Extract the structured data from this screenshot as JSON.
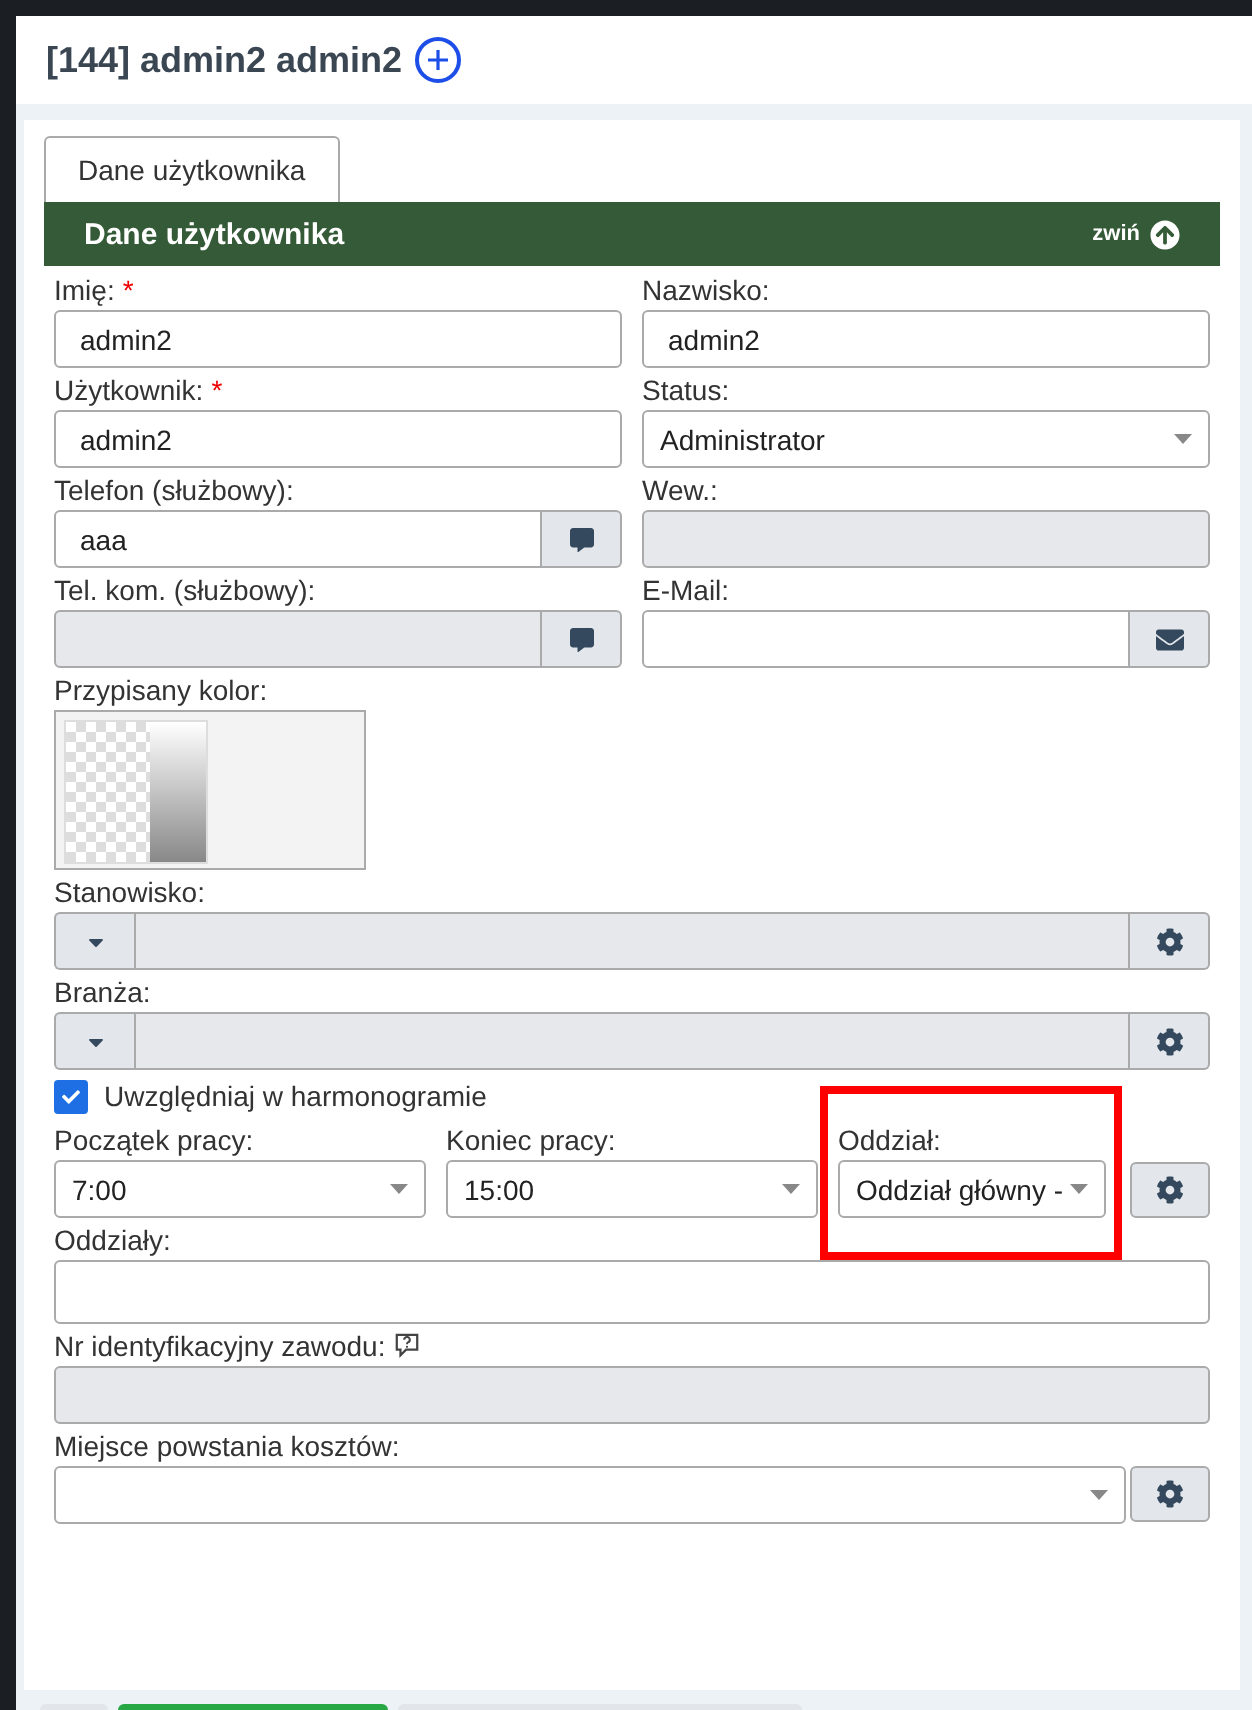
{
  "header": {
    "title": "[144] admin2 admin2"
  },
  "tabs": [
    {
      "label": "Dane użytkownika",
      "selected": true
    }
  ],
  "section": {
    "title": "Dane użytkownika",
    "collapse_label": "zwiń"
  },
  "rows": [
    [
      {
        "kind": "text",
        "label": "Imię:",
        "required_mark": "*",
        "value": "admin2",
        "disabled": false
      },
      {
        "kind": "text",
        "label": "Nazwisko:",
        "value": "admin2",
        "disabled": false
      }
    ],
    [
      {
        "kind": "text",
        "label": "Użytkownik:",
        "required_mark": "*",
        "value": "admin2",
        "disabled": false
      },
      {
        "kind": "select",
        "label": "Status:",
        "value": "Administrator"
      }
    ],
    [
      {
        "kind": "phone",
        "label": "Telefon (służbowy):",
        "value": "aaa",
        "disabled": false
      },
      {
        "kind": "text",
        "label": "Wew.:",
        "disabled": true
      }
    ],
    [
      {
        "kind": "phone",
        "label": "Tel. kom. (służbowy):",
        "disabled": true
      },
      {
        "kind": "email",
        "label": "E-Mail:",
        "disabled": false
      }
    ],
    [
      {
        "kind": "color",
        "label": "Przypisany kolor:"
      }
    ],
    [
      {
        "kind": "combo",
        "label": "Stanowisko:"
      }
    ],
    [
      {
        "kind": "combo",
        "label": "Branża:"
      }
    ],
    [
      {
        "kind": "checkbox",
        "label": "Uwzględniaj w harmonogramie",
        "checked": true
      }
    ],
    [
      {
        "kind": "select",
        "label": "Początek pracy:",
        "value": "7:00"
      },
      {
        "kind": "select",
        "label": "Koniec pracy:",
        "value": "15:00"
      },
      {
        "kind": "select",
        "label": "Oddział:",
        "value": "Oddział główny -",
        "settings": true,
        "highlighted": true
      }
    ],
    [
      {
        "kind": "multi",
        "label": "Oddziały:"
      }
    ],
    [
      {
        "kind": "text",
        "label": "Nr identyfikacyjny zawodu:",
        "hint": true,
        "disabled": true
      }
    ],
    [
      {
        "kind": "select",
        "label": "Miejsce powstania kosztów:",
        "settings": true
      }
    ]
  ],
  "footer_buttons": [
    {
      "kind": "secondary"
    },
    {
      "kind": "primary"
    },
    {
      "kind": "secondary"
    }
  ]
}
